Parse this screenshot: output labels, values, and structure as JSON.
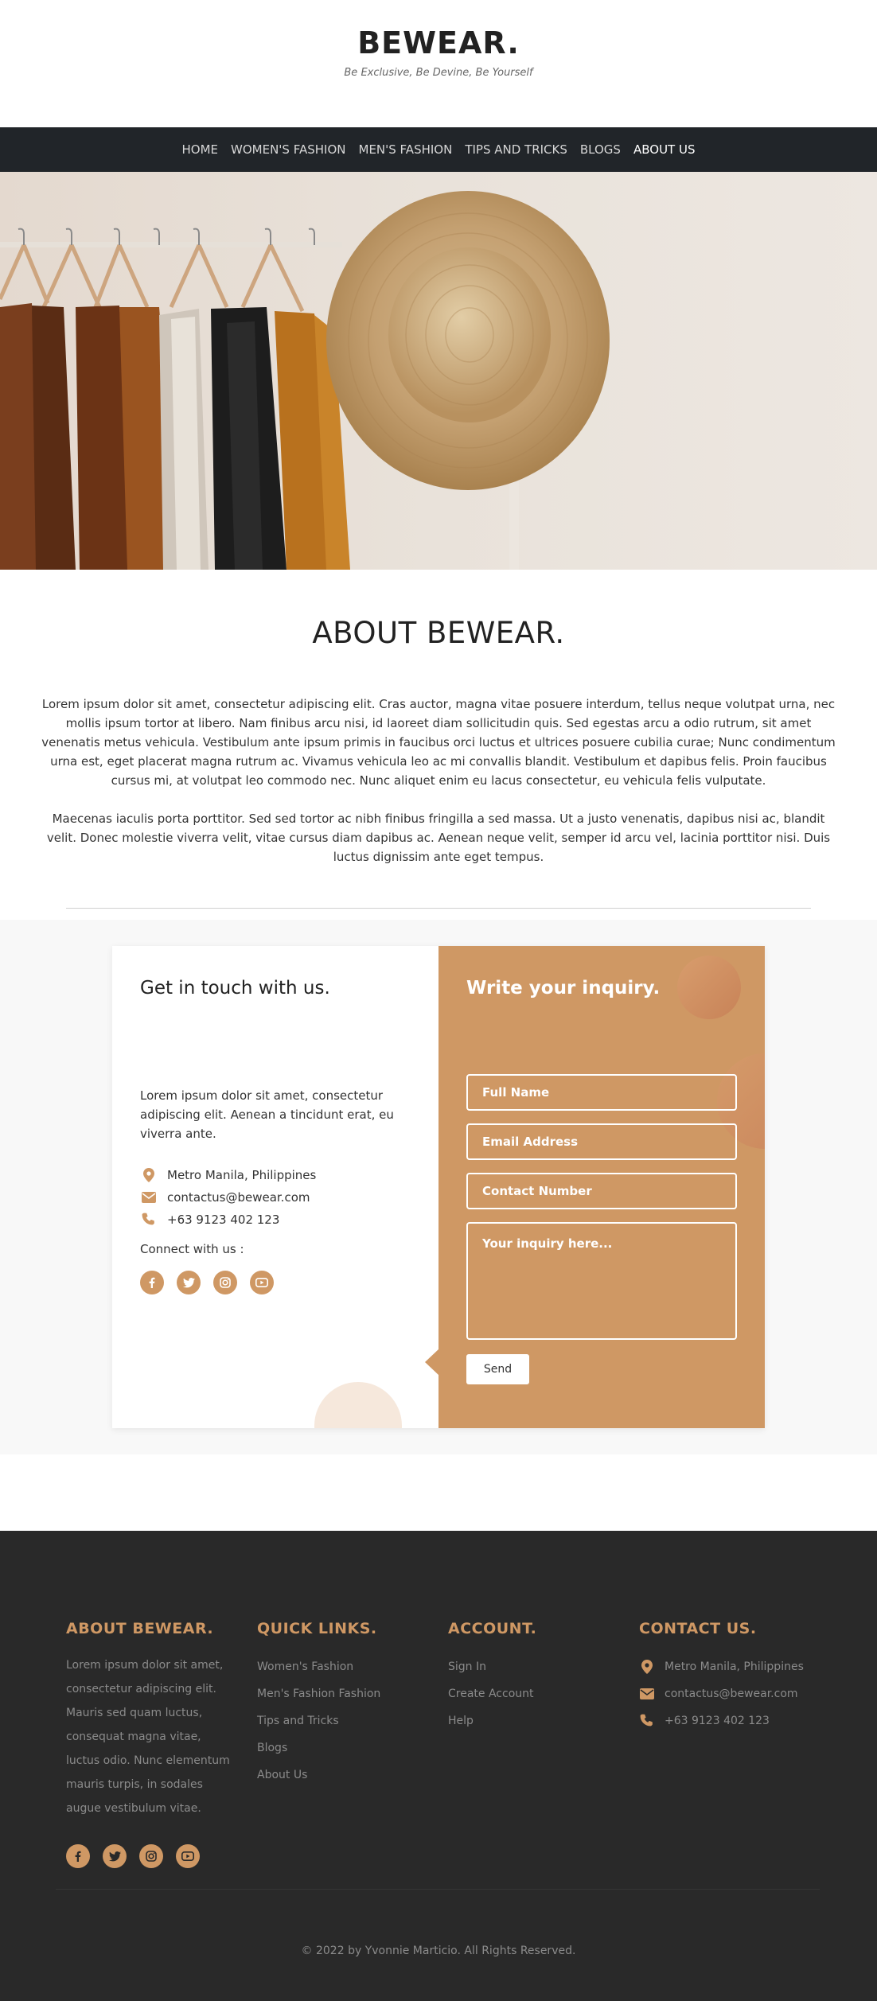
{
  "header": {
    "brand": "BEWEAR.",
    "tagline": "Be Exclusive, Be Devine, Be Yourself"
  },
  "nav": {
    "items": [
      {
        "label": "HOME"
      },
      {
        "label": "WOMEN'S FASHION"
      },
      {
        "label": "MEN'S FASHION"
      },
      {
        "label": "TIPS AND TRICKS"
      },
      {
        "label": "BLOGS"
      },
      {
        "label": "ABOUT US"
      }
    ],
    "active": "ABOUT US"
  },
  "about": {
    "title": "ABOUT BEWEAR.",
    "paragraph_1": "Lorem ipsum dolor sit amet, consectetur adipiscing elit. Cras auctor, magna vitae posuere interdum, tellus neque volutpat urna, nec mollis ipsum tortor at libero. Nam finibus arcu nisi, id laoreet diam sollicitudin quis. Sed egestas arcu a odio rutrum, sit amet venenatis metus vehicula. Vestibulum ante ipsum primis in faucibus orci luctus et ultrices posuere cubilia curae; Nunc condimentum urna est, eget placerat magna rutrum ac. Vivamus vehicula leo ac mi convallis blandit. Vestibulum et dapibus felis. Proin faucibus cursus mi, at volutpat leo commodo nec. Nunc aliquet enim eu lacus consectetur, eu vehicula felis vulputate.",
    "paragraph_2": "Maecenas iaculis porta porttitor. Sed sed tortor ac nibh finibus fringilla a sed massa. Ut a justo venenatis, dapibus nisi ac, blandit velit. Donec molestie viverra velit, vitae cursus diam dapibus ac. Aenean neque velit, semper id arcu vel, lacinia porttitor nisi. Duis luctus dignissim ante eget tempus."
  },
  "contact": {
    "heading": "Get in touch with us.",
    "description": "Lorem ipsum dolor sit amet, consectetur adipiscing elit. Aenean a tincidunt erat, eu viverra ante.",
    "address": "Metro Manila, Philippines",
    "email": "contactus@bewear.com",
    "phone": "+63 9123 402 123",
    "connect_label": "Connect with us :",
    "form": {
      "heading": "Write your inquiry.",
      "full_name_placeholder": "Full Name",
      "email_placeholder": "Email Address",
      "contact_placeholder": "Contact Number",
      "inquiry_placeholder": "Your inquiry here...",
      "send_label": "Send"
    }
  },
  "footer": {
    "about": {
      "title": "ABOUT BEWEAR.",
      "text": "Lorem ipsum dolor sit amet, consectetur adipiscing elit. Mauris sed quam luctus, consequat magna vitae, luctus odio. Nunc elementum mauris turpis, in sodales augue vestibulum vitae."
    },
    "quick_links": {
      "title": "QUICK LINKS.",
      "items": [
        "Women's Fashion",
        "Men's Fashion Fashion",
        "Tips and Tricks",
        "Blogs",
        "About Us"
      ]
    },
    "account": {
      "title": "ACCOUNT.",
      "items": [
        "Sign In",
        "Create Account",
        "Help"
      ]
    },
    "contact": {
      "title": "CONTACT US.",
      "address": "Metro Manila, Philippines",
      "email": "contactus@bewear.com",
      "phone": "+63 9123 402 123"
    },
    "copyright": "© 2022 by Yvonnie Marticio. All Rights Reserved."
  },
  "colors": {
    "accent": "#cf9864",
    "nav_bg": "#212529",
    "footer_bg": "#292929"
  },
  "icons": {
    "social": [
      "facebook-icon",
      "twitter-icon",
      "instagram-icon",
      "youtube-icon"
    ],
    "contact": [
      "map-pin-icon",
      "envelope-icon",
      "phone-icon"
    ]
  }
}
